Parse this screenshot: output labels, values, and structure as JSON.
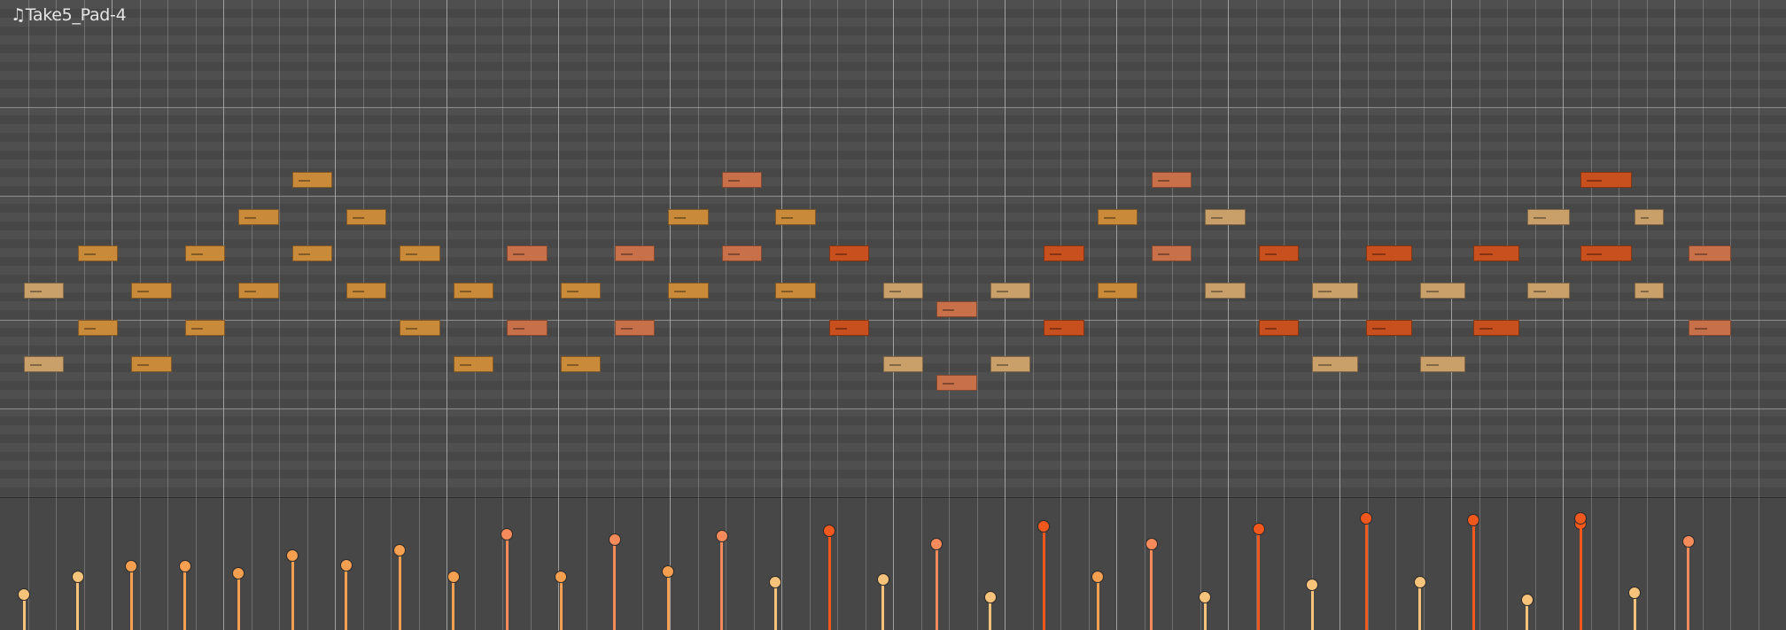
{
  "clip": {
    "title": "♫Take5_Pad-4",
    "note_icon": "music-note-icon"
  },
  "colors": {
    "background": "#474747",
    "note_light": "#c9a06a",
    "note_medium": "#c98a3a",
    "note_salmon": "#c8704a",
    "note_orange": "#c8501e",
    "velocity_light": "#f7c27a",
    "velocity_medium": "#f5a050",
    "velocity_salmon": "#f58a5a",
    "velocity_orange": "#f0581e"
  },
  "grid": {
    "beats": 64,
    "strong_every": 4,
    "pitch_rows": 48,
    "lane_separators": 4
  },
  "notes": [
    {
      "start": 0,
      "len": 0.75,
      "pitch": 30,
      "tone": "light"
    },
    {
      "start": 0,
      "len": 0.75,
      "pitch": 22,
      "tone": "light"
    },
    {
      "start": 1,
      "len": 0.75,
      "pitch": 34,
      "tone": "medium"
    },
    {
      "start": 1,
      "len": 0.75,
      "pitch": 26,
      "tone": "medium"
    },
    {
      "start": 2,
      "len": 0.75,
      "pitch": 30,
      "tone": "medium"
    },
    {
      "start": 2,
      "len": 0.75,
      "pitch": 22,
      "tone": "medium"
    },
    {
      "start": 3,
      "len": 0.75,
      "pitch": 34,
      "tone": "medium"
    },
    {
      "start": 3,
      "len": 0.75,
      "pitch": 26,
      "tone": "medium"
    },
    {
      "start": 4,
      "len": 0.75,
      "pitch": 38,
      "tone": "medium"
    },
    {
      "start": 4,
      "len": 0.75,
      "pitch": 30,
      "tone": "medium"
    },
    {
      "start": 5,
      "len": 0.75,
      "pitch": 42,
      "tone": "medium"
    },
    {
      "start": 5,
      "len": 0.75,
      "pitch": 34,
      "tone": "medium"
    },
    {
      "start": 6,
      "len": 0.75,
      "pitch": 38,
      "tone": "medium"
    },
    {
      "start": 6,
      "len": 0.75,
      "pitch": 30,
      "tone": "medium"
    },
    {
      "start": 7,
      "len": 0.75,
      "pitch": 34,
      "tone": "medium"
    },
    {
      "start": 7,
      "len": 0.75,
      "pitch": 26,
      "tone": "medium"
    },
    {
      "start": 8,
      "len": 0.75,
      "pitch": 30,
      "tone": "medium"
    },
    {
      "start": 8,
      "len": 0.75,
      "pitch": 22,
      "tone": "medium"
    },
    {
      "start": 9,
      "len": 0.75,
      "pitch": 34,
      "tone": "salmon"
    },
    {
      "start": 9,
      "len": 0.75,
      "pitch": 26,
      "tone": "salmon"
    },
    {
      "start": 10,
      "len": 0.75,
      "pitch": 30,
      "tone": "medium"
    },
    {
      "start": 10,
      "len": 0.75,
      "pitch": 22,
      "tone": "medium"
    },
    {
      "start": 11,
      "len": 0.75,
      "pitch": 34,
      "tone": "salmon"
    },
    {
      "start": 11,
      "len": 0.75,
      "pitch": 26,
      "tone": "salmon"
    },
    {
      "start": 12,
      "len": 0.75,
      "pitch": 38,
      "tone": "medium"
    },
    {
      "start": 12,
      "len": 0.75,
      "pitch": 30,
      "tone": "medium"
    },
    {
      "start": 13,
      "len": 0.75,
      "pitch": 42,
      "tone": "salmon"
    },
    {
      "start": 13,
      "len": 0.75,
      "pitch": 34,
      "tone": "salmon"
    },
    {
      "start": 14,
      "len": 0.75,
      "pitch": 38,
      "tone": "medium"
    },
    {
      "start": 14,
      "len": 0.75,
      "pitch": 30,
      "tone": "medium"
    },
    {
      "start": 15,
      "len": 0.75,
      "pitch": 34,
      "tone": "orange"
    },
    {
      "start": 15,
      "len": 0.75,
      "pitch": 26,
      "tone": "orange"
    },
    {
      "start": 16,
      "len": 0.75,
      "pitch": 30,
      "tone": "light"
    },
    {
      "start": 16,
      "len": 0.75,
      "pitch": 22,
      "tone": "light"
    },
    {
      "start": 17,
      "len": 0.75,
      "pitch": 28,
      "tone": "salmon"
    },
    {
      "start": 17,
      "len": 0.75,
      "pitch": 20,
      "tone": "salmon"
    },
    {
      "start": 18,
      "len": 0.75,
      "pitch": 30,
      "tone": "light"
    },
    {
      "start": 18,
      "len": 0.75,
      "pitch": 22,
      "tone": "light"
    },
    {
      "start": 19,
      "len": 0.75,
      "pitch": 34,
      "tone": "orange"
    },
    {
      "start": 19,
      "len": 0.75,
      "pitch": 26,
      "tone": "orange"
    },
    {
      "start": 20,
      "len": 0.75,
      "pitch": 38,
      "tone": "medium"
    },
    {
      "start": 20,
      "len": 0.75,
      "pitch": 30,
      "tone": "medium"
    },
    {
      "start": 21,
      "len": 0.75,
      "pitch": 42,
      "tone": "salmon"
    },
    {
      "start": 21,
      "len": 0.75,
      "pitch": 34,
      "tone": "salmon"
    },
    {
      "start": 22,
      "len": 0.75,
      "pitch": 38,
      "tone": "light"
    },
    {
      "start": 22,
      "len": 0.75,
      "pitch": 30,
      "tone": "light"
    },
    {
      "start": 23,
      "len": 0.75,
      "pitch": 34,
      "tone": "orange"
    },
    {
      "start": 23,
      "len": 0.75,
      "pitch": 26,
      "tone": "orange"
    },
    {
      "start": 24,
      "len": 0.85,
      "pitch": 30,
      "tone": "light"
    },
    {
      "start": 24,
      "len": 0.85,
      "pitch": 22,
      "tone": "light"
    },
    {
      "start": 25,
      "len": 0.85,
      "pitch": 34,
      "tone": "orange"
    },
    {
      "start": 25,
      "len": 0.85,
      "pitch": 26,
      "tone": "orange"
    },
    {
      "start": 26,
      "len": 0.85,
      "pitch": 30,
      "tone": "light"
    },
    {
      "start": 26,
      "len": 0.85,
      "pitch": 22,
      "tone": "light"
    },
    {
      "start": 27,
      "len": 0.85,
      "pitch": 34,
      "tone": "orange"
    },
    {
      "start": 27,
      "len": 0.85,
      "pitch": 26,
      "tone": "orange"
    },
    {
      "start": 28,
      "len": 0.8,
      "pitch": 38,
      "tone": "light"
    },
    {
      "start": 28,
      "len": 0.8,
      "pitch": 30,
      "tone": "light"
    },
    {
      "start": 29,
      "len": 0.95,
      "pitch": 42,
      "tone": "orange"
    },
    {
      "start": 29,
      "len": 0.95,
      "pitch": 34,
      "tone": "orange"
    },
    {
      "start": 30,
      "len": 0.55,
      "pitch": 38,
      "tone": "light"
    },
    {
      "start": 30,
      "len": 0.55,
      "pitch": 30,
      "tone": "light"
    },
    {
      "start": 31,
      "len": 0.8,
      "pitch": 34,
      "tone": "salmon"
    },
    {
      "start": 31,
      "len": 0.8,
      "pitch": 26,
      "tone": "salmon"
    }
  ],
  "velocities": [
    {
      "step": 0,
      "value": 0.27,
      "tone": "light"
    },
    {
      "step": 1,
      "value": 0.4,
      "tone": "light"
    },
    {
      "step": 2,
      "value": 0.48,
      "tone": "medium"
    },
    {
      "step": 3,
      "value": 0.48,
      "tone": "medium"
    },
    {
      "step": 4,
      "value": 0.43,
      "tone": "medium"
    },
    {
      "step": 5,
      "value": 0.56,
      "tone": "medium"
    },
    {
      "step": 6,
      "value": 0.49,
      "tone": "medium"
    },
    {
      "step": 7,
      "value": 0.6,
      "tone": "medium"
    },
    {
      "step": 8,
      "value": 0.4,
      "tone": "medium"
    },
    {
      "step": 9,
      "value": 0.72,
      "tone": "salmon"
    },
    {
      "step": 10,
      "value": 0.4,
      "tone": "medium"
    },
    {
      "step": 11,
      "value": 0.68,
      "tone": "salmon"
    },
    {
      "step": 12,
      "value": 0.44,
      "tone": "medium"
    },
    {
      "step": 13,
      "value": 0.71,
      "tone": "salmon"
    },
    {
      "step": 14,
      "value": 0.36,
      "tone": "light"
    },
    {
      "step": 15,
      "value": 0.75,
      "tone": "orange"
    },
    {
      "step": 16,
      "value": 0.38,
      "tone": "light"
    },
    {
      "step": 17,
      "value": 0.65,
      "tone": "salmon"
    },
    {
      "step": 18,
      "value": 0.25,
      "tone": "light"
    },
    {
      "step": 19,
      "value": 0.78,
      "tone": "orange"
    },
    {
      "step": 20,
      "value": 0.4,
      "tone": "medium"
    },
    {
      "step": 21,
      "value": 0.65,
      "tone": "salmon"
    },
    {
      "step": 22,
      "value": 0.25,
      "tone": "light"
    },
    {
      "step": 23,
      "value": 0.76,
      "tone": "orange"
    },
    {
      "step": 24,
      "value": 0.34,
      "tone": "light"
    },
    {
      "step": 25,
      "value": 0.84,
      "tone": "orange"
    },
    {
      "step": 26,
      "value": 0.36,
      "tone": "light"
    },
    {
      "step": 27,
      "value": 0.83,
      "tone": "orange"
    },
    {
      "step": 28,
      "value": 0.23,
      "tone": "light"
    },
    {
      "step": 29,
      "value": 0.8,
      "tone": "orange"
    },
    {
      "step": 29,
      "value": 0.84,
      "tone": "orange"
    },
    {
      "step": 30,
      "value": 0.28,
      "tone": "light"
    },
    {
      "step": 31,
      "value": 0.67,
      "tone": "salmon"
    }
  ]
}
